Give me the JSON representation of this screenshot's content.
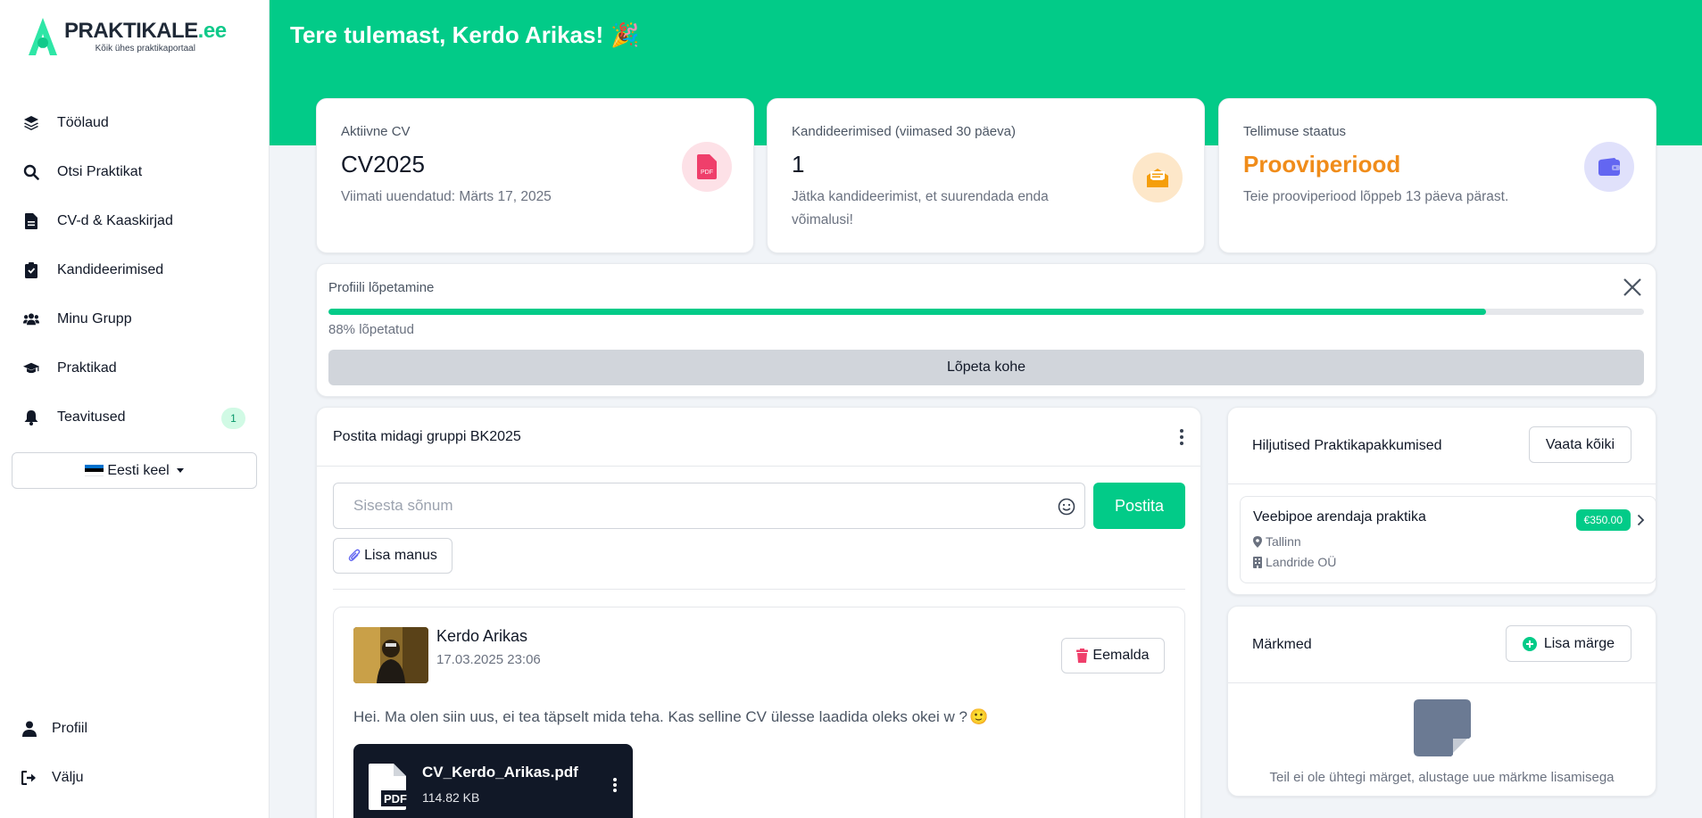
{
  "brand": {
    "name": "PRAKTIKALE",
    "tld": ".ee",
    "tagline": "Kõik ühes praktikaportaal"
  },
  "sidebar": {
    "items": [
      {
        "label": "Töölaud",
        "icon": "layers-icon"
      },
      {
        "label": "Otsi Praktikat",
        "icon": "search-icon"
      },
      {
        "label": "CV-d & Kaaskirjad",
        "icon": "file-icon"
      },
      {
        "label": "Kandideerimised",
        "icon": "clipboard-icon"
      },
      {
        "label": "Minu Grupp",
        "icon": "users-icon"
      },
      {
        "label": "Praktikad",
        "icon": "graduation-cap-icon"
      },
      {
        "label": "Teavitused",
        "icon": "bell-icon",
        "badge": "1"
      }
    ],
    "language": "Eesti keel",
    "bottom": [
      {
        "label": "Profiil",
        "icon": "user-icon"
      },
      {
        "label": "Välju",
        "icon": "logout-icon"
      }
    ]
  },
  "header": {
    "welcome": "Tere tulemast, Kerdo Arikas!",
    "emoji": "🎉"
  },
  "stats": [
    {
      "label": "Aktiivne CV",
      "value": "CV2025",
      "desc": "Viimati uuendatud: Märts 17, 2025",
      "icon": "pdf-file-icon",
      "icon_bg": "#fde1e7",
      "icon_color": "#ef3f6b"
    },
    {
      "label": "Kandideerimised (viimased 30 päeva)",
      "value": "1",
      "desc": "Jätka kandideerimist, et suurendada enda võimalusi!",
      "icon": "envelope-open-icon",
      "icon_bg": "#fde7c9",
      "icon_color": "#f59e0b"
    },
    {
      "label": "Tellimuse staatus",
      "value": "Prooviperiood",
      "desc": "Teie prooviperiood lõppeb 13 päeva pärast.",
      "icon": "wallet-icon",
      "icon_bg": "#e0e1fb",
      "icon_color": "#6366f1"
    }
  ],
  "profile_progress": {
    "title": "Profiili lõpetamine",
    "percent": 88,
    "text": "88% lõpetatud",
    "button": "Lõpeta kohe"
  },
  "group": {
    "title": "Postita midagi gruppi BK2025",
    "input_placeholder": "Sisesta sõnum",
    "post_button": "Postita",
    "attach_button": "Lisa manus",
    "post": {
      "author": "Kerdo Arikas",
      "date": "17.03.2025 23:06",
      "remove_button": "Eemalda",
      "text": "Hei. Ma olen siin uus, ei tea täpselt mida teha. Kas selline CV ülesse laadida oleks okei w ?",
      "emoji": "🙂",
      "file": {
        "name": "CV_Kerdo_Arikas.pdf",
        "size": "114.82 KB"
      }
    }
  },
  "recent_offers": {
    "title": "Hiljutised Praktikapakkumised",
    "button": "Vaata kõiki",
    "items": [
      {
        "title": "Veebipoe arendaja praktika",
        "location": "Tallinn",
        "company": "Landride OÜ",
        "price": "€350.00"
      }
    ]
  },
  "notes": {
    "title": "Märkmed",
    "button": "Lisa märge",
    "empty_text": "Teil ei ole ühtegi märget, alustage uue märkme lisamisega"
  },
  "colors": {
    "accent": "#02cb88",
    "orange": "#f08c1a"
  }
}
